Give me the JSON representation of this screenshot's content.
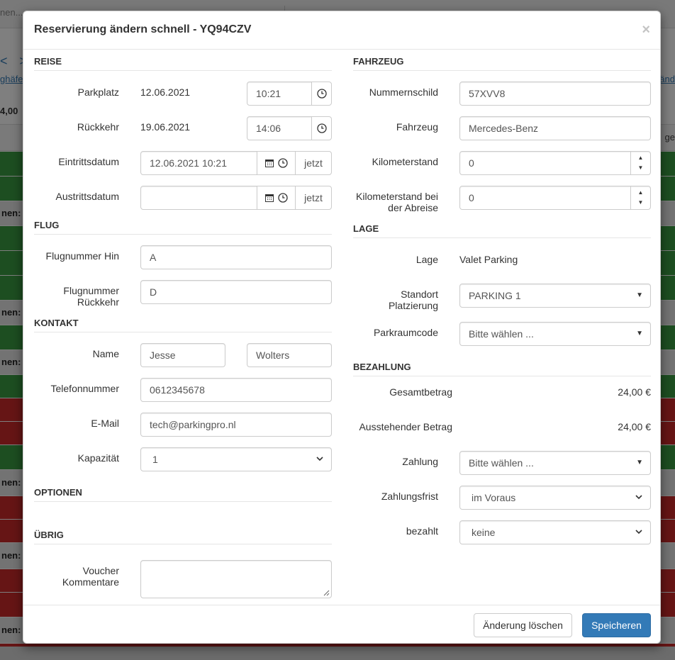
{
  "background": {
    "search_placeholder": "nen...",
    "nav_arrows": "< >",
    "link_left": "ghäfe",
    "link_right": "änd",
    "total_text": "4,00",
    "right_text": "ge",
    "group_rows": [
      "nen: :",
      "nen: :",
      "nen: 4",
      "nen: :",
      "nen: :",
      "nen: :"
    ]
  },
  "modal": {
    "title": "Reservierung ändern schnell - YQ94CZV",
    "close_label": "×",
    "left": {
      "reise": {
        "heading": "REISE",
        "parkplatz_label": "Parkplatz",
        "parkplatz_date": "12.06.2021",
        "parkplatz_time": "10:21",
        "rueckkehr_label": "Rückkehr",
        "rueckkehr_date": "19.06.2021",
        "rueckkehr_time": "14:06",
        "eintritt_label": "Eintrittsdatum",
        "eintritt_value": "12.06.2021 10:21",
        "eintritt_now": "jetzt",
        "austritt_label": "Austrittsdatum",
        "austritt_value": "",
        "austritt_now": "jetzt"
      },
      "flug": {
        "heading": "FLUG",
        "hin_label": "Flugnummer Hin",
        "hin_value": "A",
        "rueck_label_1": "Flugnummer",
        "rueck_label_2": "Rückkehr",
        "rueck_value": "D"
      },
      "kontakt": {
        "heading": "KONTAKT",
        "name_label": "Name",
        "first_name": "Jesse",
        "last_name": "Wolters",
        "phone_label": "Telefonnummer",
        "phone_value": "0612345678",
        "email_label": "E-Mail",
        "email_value": "tech@parkingpro.nl",
        "capacity_label": "Kapazität",
        "capacity_value": "1"
      },
      "optionen": {
        "heading": "OPTIONEN"
      },
      "uebrig": {
        "heading": "ÜBRIG",
        "voucher_label_1": "Voucher",
        "voucher_label_2": "Kommentare",
        "voucher_value": ""
      }
    },
    "right": {
      "fahrzeug": {
        "heading": "FAHRZEUG",
        "plate_label": "Nummernschild",
        "plate_value": "57XVV8",
        "vehicle_label": "Fahrzeug",
        "vehicle_value": "Mercedes-Benz",
        "km_label": "Kilometerstand",
        "km_value": "0",
        "km_dep_label_1": "Kilometerstand bei",
        "km_dep_label_2": "der Abreise",
        "km_dep_value": "0"
      },
      "lage": {
        "heading": "LAGE",
        "lage_label": "Lage",
        "lage_value": "Valet Parking",
        "standort_label_1": "Standort",
        "standort_label_2": "Platzierung",
        "standort_value": "PARKING 1",
        "code_label": "Parkraumcode",
        "code_value": "Bitte wählen ..."
      },
      "bezahlung": {
        "heading": "BEZAHLUNG",
        "total_label": "Gesamtbetrag",
        "total_value": "24,00 €",
        "outstanding_label": "Ausstehender Betrag",
        "outstanding_value": "24,00 €",
        "payment_label": "Zahlung",
        "payment_value": "Bitte wählen ...",
        "term_label": "Zahlungsfrist",
        "term_value": "im Voraus",
        "paid_label": "bezahlt",
        "paid_value": "keine"
      }
    },
    "footer": {
      "delete_label": "Änderung löschen",
      "save_label": "Speicheren"
    }
  },
  "colors": {
    "primary": "#337ab7",
    "row_green": "#3b9c43",
    "row_red": "#cc2b2b"
  }
}
